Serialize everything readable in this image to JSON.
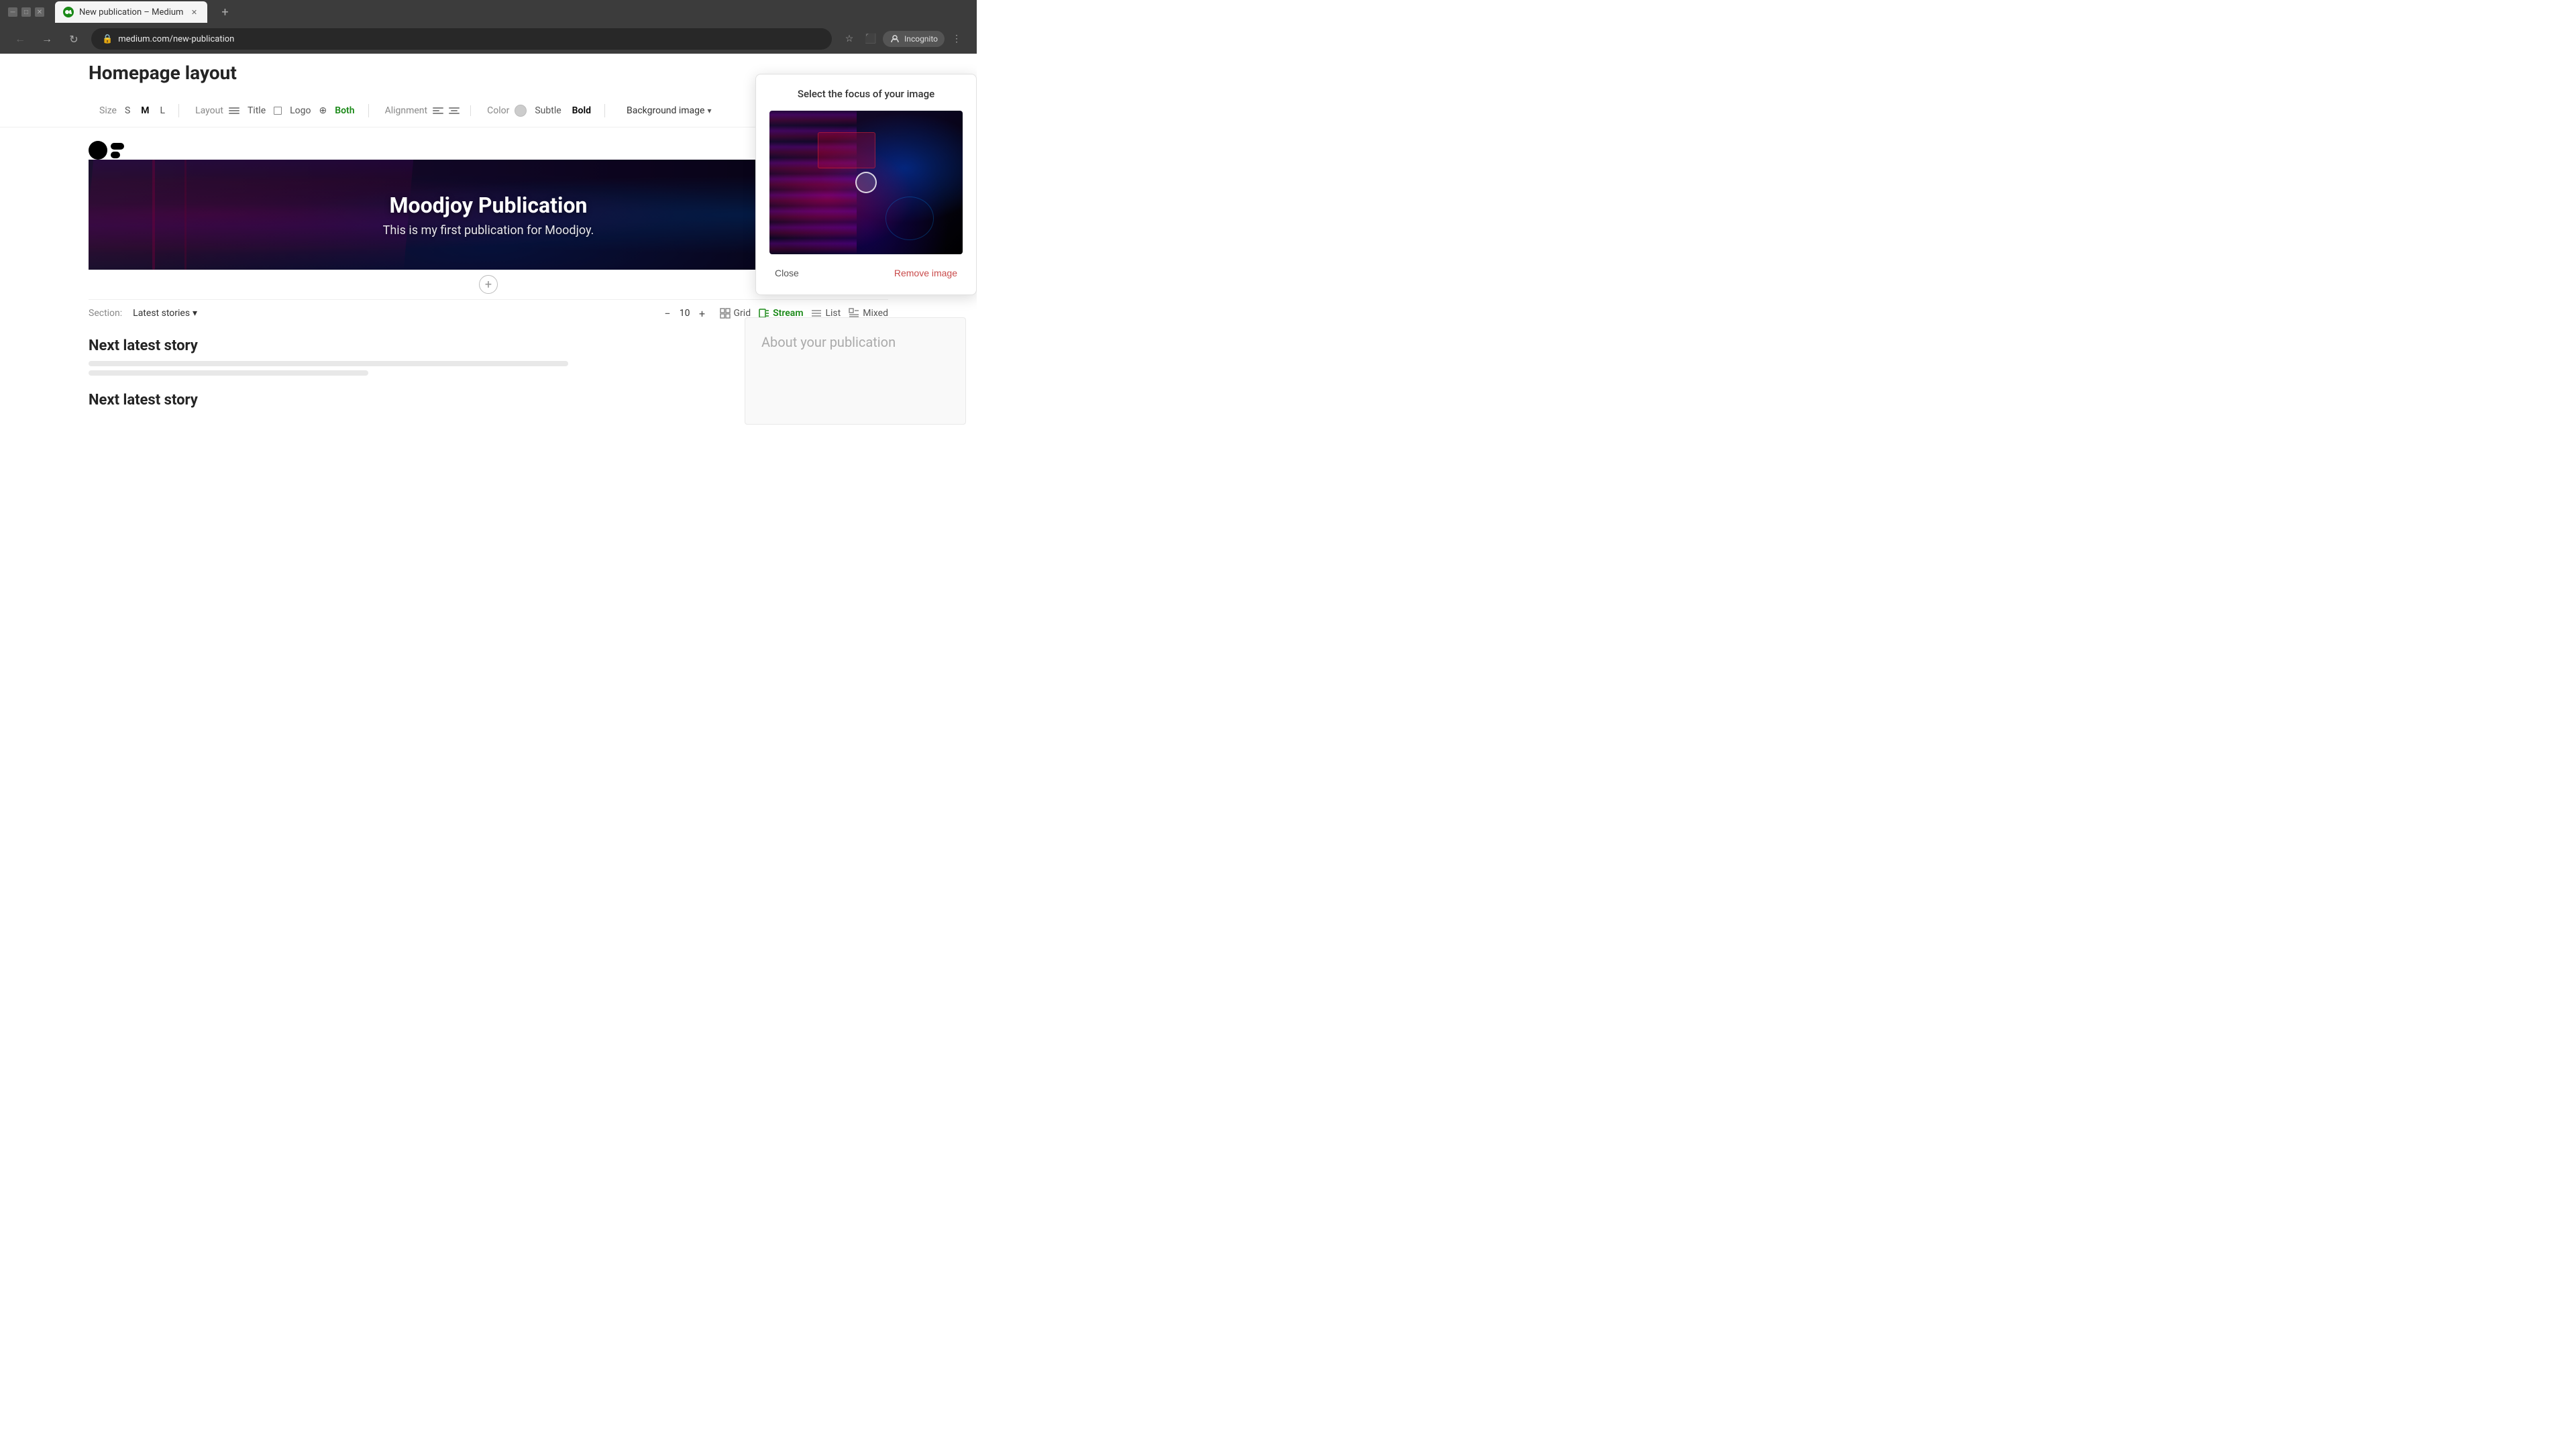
{
  "browser": {
    "tab_title": "New publication – Medium",
    "url": "medium.com/new-publication",
    "incognito_label": "Incognito"
  },
  "toolbar": {
    "size_label": "Size",
    "size_s": "S",
    "size_m": "M",
    "size_l": "L",
    "layout_label": "Layout",
    "layout_title": "Title",
    "layout_logo": "Logo",
    "layout_both": "Both",
    "alignment_label": "Alignment",
    "color_label": "Color",
    "color_subtle": "Subtle",
    "color_bold": "Bold",
    "bg_image_label": "Background image"
  },
  "popup": {
    "title": "Select the focus of your image",
    "close_btn": "Close",
    "remove_btn": "Remove image"
  },
  "page": {
    "section_title": "Homepage layout",
    "pub_title": "Moodjoy Publication",
    "pub_subtitle": "This is my first publication for Moodjoy.",
    "section_label": "Section:",
    "section_name": "Latest stories",
    "count": "10",
    "view_grid": "Grid",
    "view_stream": "Stream",
    "view_list": "List",
    "view_mixed": "Mixed",
    "next_story_1": "Next latest story",
    "next_story_2": "Next latest story",
    "about_title": "About your publication"
  }
}
